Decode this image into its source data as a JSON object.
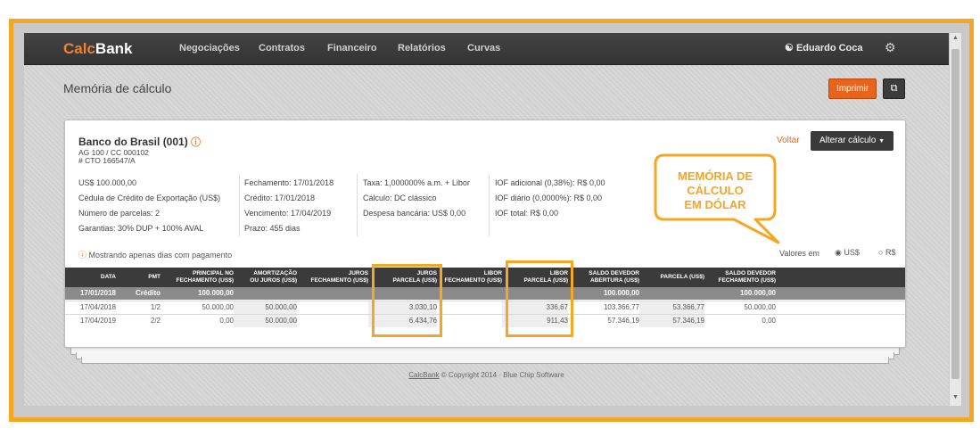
{
  "brand": {
    "calc": "Calc",
    "bank": "Bank"
  },
  "nav": [
    "Negociações",
    "Contratos",
    "Financeiro",
    "Relatórios",
    "Curvas"
  ],
  "user": {
    "name": "Eduardo Coca"
  },
  "page": {
    "title": "Memória de cálculo",
    "print_label": "Imprimir"
  },
  "card": {
    "bank_name": "Banco do Brasil (001)",
    "ag": "AG 100 / CC 000102",
    "cto": "# CTO 166547/A",
    "voltar": "Voltar",
    "alter_label": "Alterar cálculo",
    "col1": [
      "US$ 100.000,00",
      "Cédula de Crédito de Exportação (US$)",
      "Número de parcelas: 2",
      "Garantias: 30% DUP + 100% AVAL"
    ],
    "col2": [
      "Fechamento: 17/01/2018",
      "Crédito: 17/01/2018",
      "Vencimento: 17/04/2019",
      "Prazo: 455 dias"
    ],
    "col3": [
      "Taxa: 1,000000% a.m. + Libor",
      "Cálculo: DC clássico",
      "Despesa bancária: US$ 0,00"
    ],
    "col4": [
      "IOF adicional (0,38%): R$ 0,00",
      "IOF diário (0,0000%): R$ 0,00",
      "IOF total: R$ 0,00"
    ],
    "showing": "Mostrando apenas dias com pagamento",
    "valores_label": "Valores em",
    "currency_usd": "US$",
    "currency_brl": "R$"
  },
  "table": {
    "headers": [
      [
        "DATA"
      ],
      [
        "PMT"
      ],
      [
        "PRINCIPAL NO",
        "FECHAMENTO (US$)"
      ],
      [
        "AMORTIZAÇÃO",
        "OU JUROS (US$)"
      ],
      [
        "JUROS",
        "FECHAMENTO (US$)"
      ],
      [
        "JUROS",
        "PARCELA (US$)"
      ],
      [
        "LIBOR",
        "FECHAMENTO (US$)"
      ],
      [
        "LIBOR",
        "PARCELA (US$)"
      ],
      [
        "SALDO DEVEDOR",
        "ABERTURA (US$)"
      ],
      [
        "PARCELA (US$)"
      ],
      [
        "SALDO DEVEDOR",
        "FECHAMENTO (US$)"
      ]
    ],
    "rows": [
      [
        "17/01/2018",
        "Crédito",
        "100.000,00",
        "",
        "",
        "",
        "",
        "",
        "100.000,00",
        "",
        "100.000,00"
      ],
      [
        "17/04/2018",
        "1/2",
        "50.000,00",
        "50.000,00",
        "",
        "3.030,10",
        "",
        "336,67",
        "103.366,77",
        "53.366,77",
        "50.000,00"
      ],
      [
        "17/04/2019",
        "2/2",
        "0,00",
        "50.000,00",
        "",
        "6.434,76",
        "",
        "911,43",
        "57.346,19",
        "57.346,19",
        "0,00"
      ]
    ]
  },
  "callout": {
    "lines": [
      "MEMÓRIA DE",
      "CÁLCULO",
      "EM DÓLAR"
    ]
  },
  "footer": {
    "link": "CalcBank",
    "text": " © Copyright 2014 · Blue Chip Software"
  },
  "colors": {
    "accent": "#f5a623",
    "brand_orange": "#e8641c",
    "nav_dark": "#3a3a3a"
  },
  "icons": {
    "user": "user-icon",
    "settings": "gear-icon",
    "copy": "copy-icon",
    "caret": "chevron-down-icon"
  }
}
